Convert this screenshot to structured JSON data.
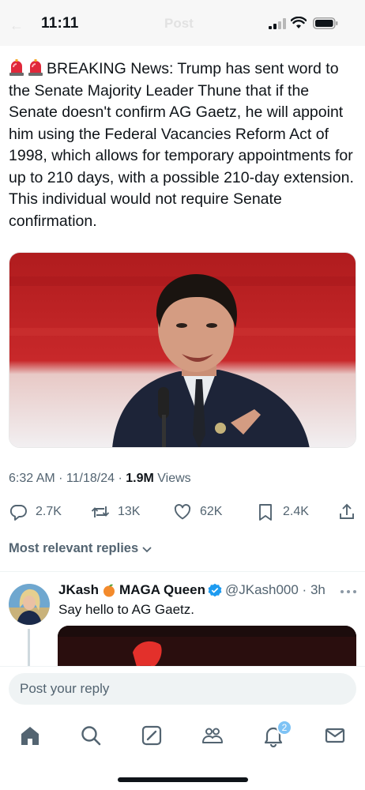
{
  "status_bar": {
    "time": "11:11"
  },
  "header": {
    "title": "Post"
  },
  "tweet": {
    "text": "BREAKING News: Trump has sent word to the Senate Majority Leader Thune that if the Senate doesn't confirm AG Gaetz, he will appoint him using the Federal Vacancies Reform Act of 1998, which allows for temporary appointments for up to 210 days, with a possible 210-day extension. This individual would not require Senate confirmation.",
    "timestamp": "6:32 AM · 11/18/24 · ",
    "views_count": "1.9M",
    "views_label": " Views"
  },
  "actions": {
    "replies": "2.7K",
    "reposts": "13K",
    "likes": "62K",
    "bookmarks": "2.4K"
  },
  "replies_sort": {
    "label": "Most relevant replies"
  },
  "reply": {
    "name_part1": "JKash",
    "name_part2": "MAGA Queen",
    "handle_time": "@JKash000 · 3h",
    "text": "Say hello to AG Gaetz."
  },
  "composer": {
    "placeholder": "Post your reply"
  },
  "tabbar": {
    "notifications_badge": "2"
  },
  "colors": {
    "text": "#0f1419",
    "muted": "#536471",
    "accent": "#1d9bf0"
  },
  "icons": [
    "siren-emoji",
    "reply-icon",
    "repost-icon",
    "like-icon",
    "bookmark-icon",
    "share-icon",
    "verified-badge-icon",
    "peach-emoji",
    "home-icon",
    "search-icon",
    "grok-icon",
    "communities-icon",
    "notifications-icon",
    "messages-icon"
  ]
}
